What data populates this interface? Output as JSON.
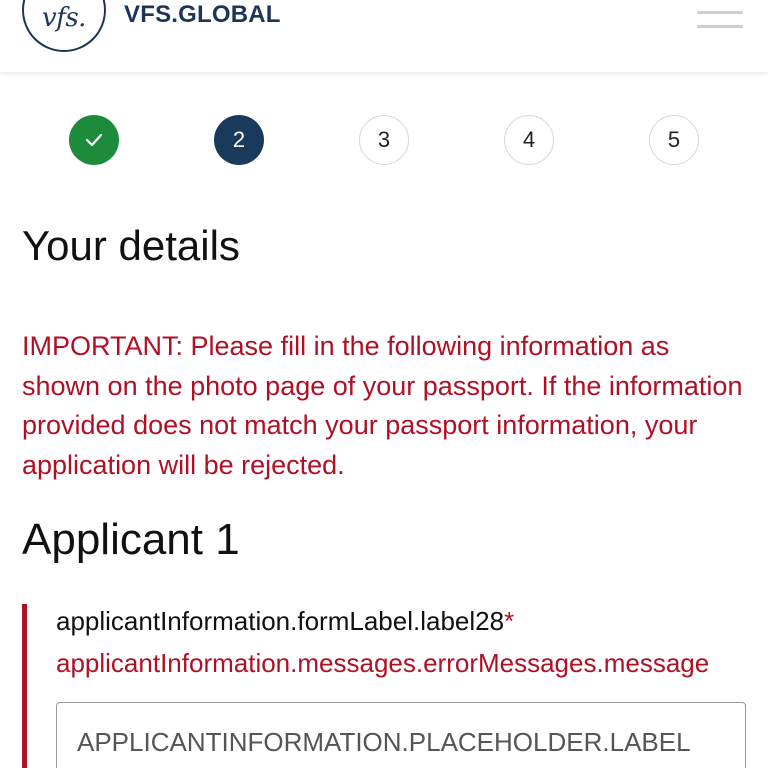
{
  "header": {
    "logo_text": "vfs.",
    "brand": "VFS.GLOBAL"
  },
  "stepper": {
    "steps": [
      {
        "label": "✓",
        "state": "done"
      },
      {
        "label": "2",
        "state": "active"
      },
      {
        "label": "3",
        "state": "todo"
      },
      {
        "label": "4",
        "state": "todo"
      },
      {
        "label": "5",
        "state": "todo"
      }
    ]
  },
  "page": {
    "title": "Your details",
    "important_notice": "IMPORTANT: Please fill in the following information as shown on the photo page of your passport. If the information provided does not match your passport information, your application will be rejected.",
    "applicant_heading": "Applicant 1"
  },
  "field": {
    "label": "applicantInformation.formLabel.label28",
    "required_mark": "*",
    "error": "applicantInformation.messages.errorMessages.message",
    "placeholder": "APPLICANTINFORMATION.PLACEHOLDER.LABEL",
    "value": ""
  },
  "colors": {
    "brand": "#1d3557",
    "step_done": "#1e8a3c",
    "step_active": "#1a3a5c",
    "error": "#b01025"
  },
  "icons": {
    "menu": "hamburger-menu-icon",
    "step_done": "checkmark-icon"
  }
}
